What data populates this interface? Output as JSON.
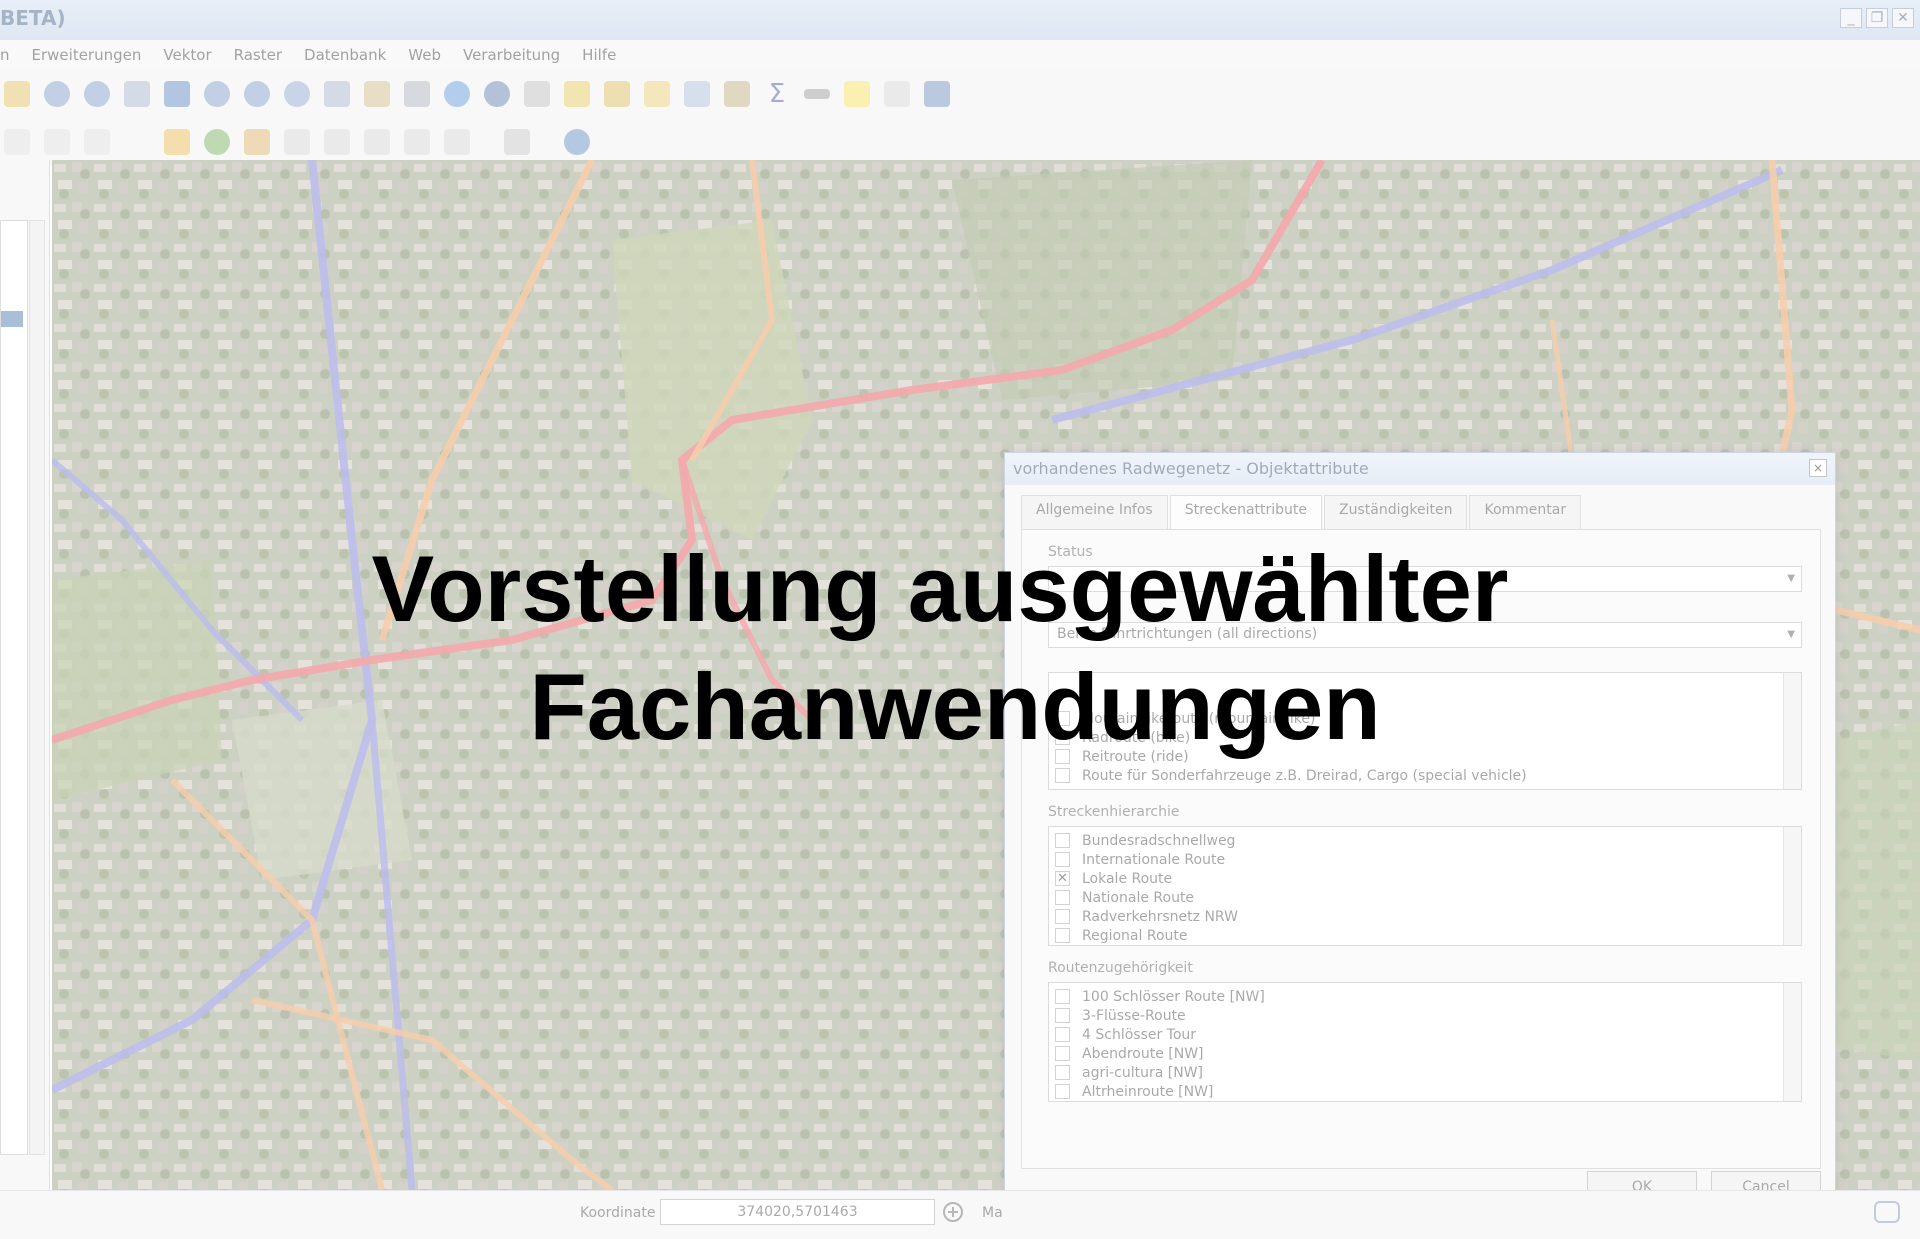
{
  "window": {
    "title": "BETA)",
    "controls": [
      "_",
      "❐",
      "✕"
    ]
  },
  "menu": [
    "n",
    "Erweiterungen",
    "Vektor",
    "Raster",
    "Datenbank",
    "Web",
    "Verarbeitung",
    "Hilfe"
  ],
  "statusbar": {
    "coordinate_label": "Koordinate",
    "coordinate_value": "374020,5701463",
    "scale_label": "Ma"
  },
  "dialog": {
    "title": "vorhandenes Radwegenetz - Objektattribute",
    "close": "×",
    "tabs": [
      "Allgemeine Infos",
      "Streckenattribute",
      "Zuständigkeiten",
      "Kommentar"
    ],
    "active_tab": "Streckenattribute",
    "status_label": "Status",
    "status_value": "",
    "direction_label": "",
    "direction_value": "Beide Fahrtrichtungen (all directions)",
    "route_types": [
      {
        "label": "Moutainbikeroute (mountainbike)",
        "checked": false
      },
      {
        "label": "Radroute (bike)",
        "checked": true
      },
      {
        "label": "Reitroute (ride)",
        "checked": false
      },
      {
        "label": "Route für Sonderfahrzeuge z.B. Dreirad, Cargo (special vehicle)",
        "checked": false
      }
    ],
    "hierarchy_label": "Streckenhierarchie",
    "hierarchy": [
      {
        "label": "Bundesradschnellweg",
        "checked": false
      },
      {
        "label": "Internationale Route",
        "checked": false
      },
      {
        "label": "Lokale Route",
        "checked": true
      },
      {
        "label": "Nationale Route",
        "checked": false
      },
      {
        "label": "Radverkehrsnetz NRW",
        "checked": false
      },
      {
        "label": "Regional Route",
        "checked": false
      }
    ],
    "membership_label": "Routenzugehörigkeit",
    "membership": [
      {
        "label": "100 Schlösser Route [NW]",
        "checked": false
      },
      {
        "label": "3-Flüsse-Route",
        "checked": false
      },
      {
        "label": "4 Schlösser Tour",
        "checked": false
      },
      {
        "label": "Abendroute [NW]",
        "checked": false
      },
      {
        "label": "agri-cultura [NW]",
        "checked": false
      },
      {
        "label": "Altrheinroute [NW]",
        "checked": false
      }
    ],
    "ok_label": "OK",
    "cancel_label": "Cancel"
  },
  "slide": {
    "title_line1": "Vorstellung ausgewählter",
    "title_line2": "Fachanwendungen"
  },
  "icons": [
    "pan-icon",
    "zoom-in-icon",
    "zoom-out-icon",
    "zoom-full-icon",
    "identify-icon",
    "select-icon",
    "attribute-table-icon",
    "statistics-sigma-icon",
    "measure-icon",
    "annotation-icon",
    "python-icon",
    "refresh-icon"
  ],
  "colors": {
    "route_red": "#e8323c",
    "route_blue": "#5f63d8",
    "route_orange": "#f08a3a"
  }
}
